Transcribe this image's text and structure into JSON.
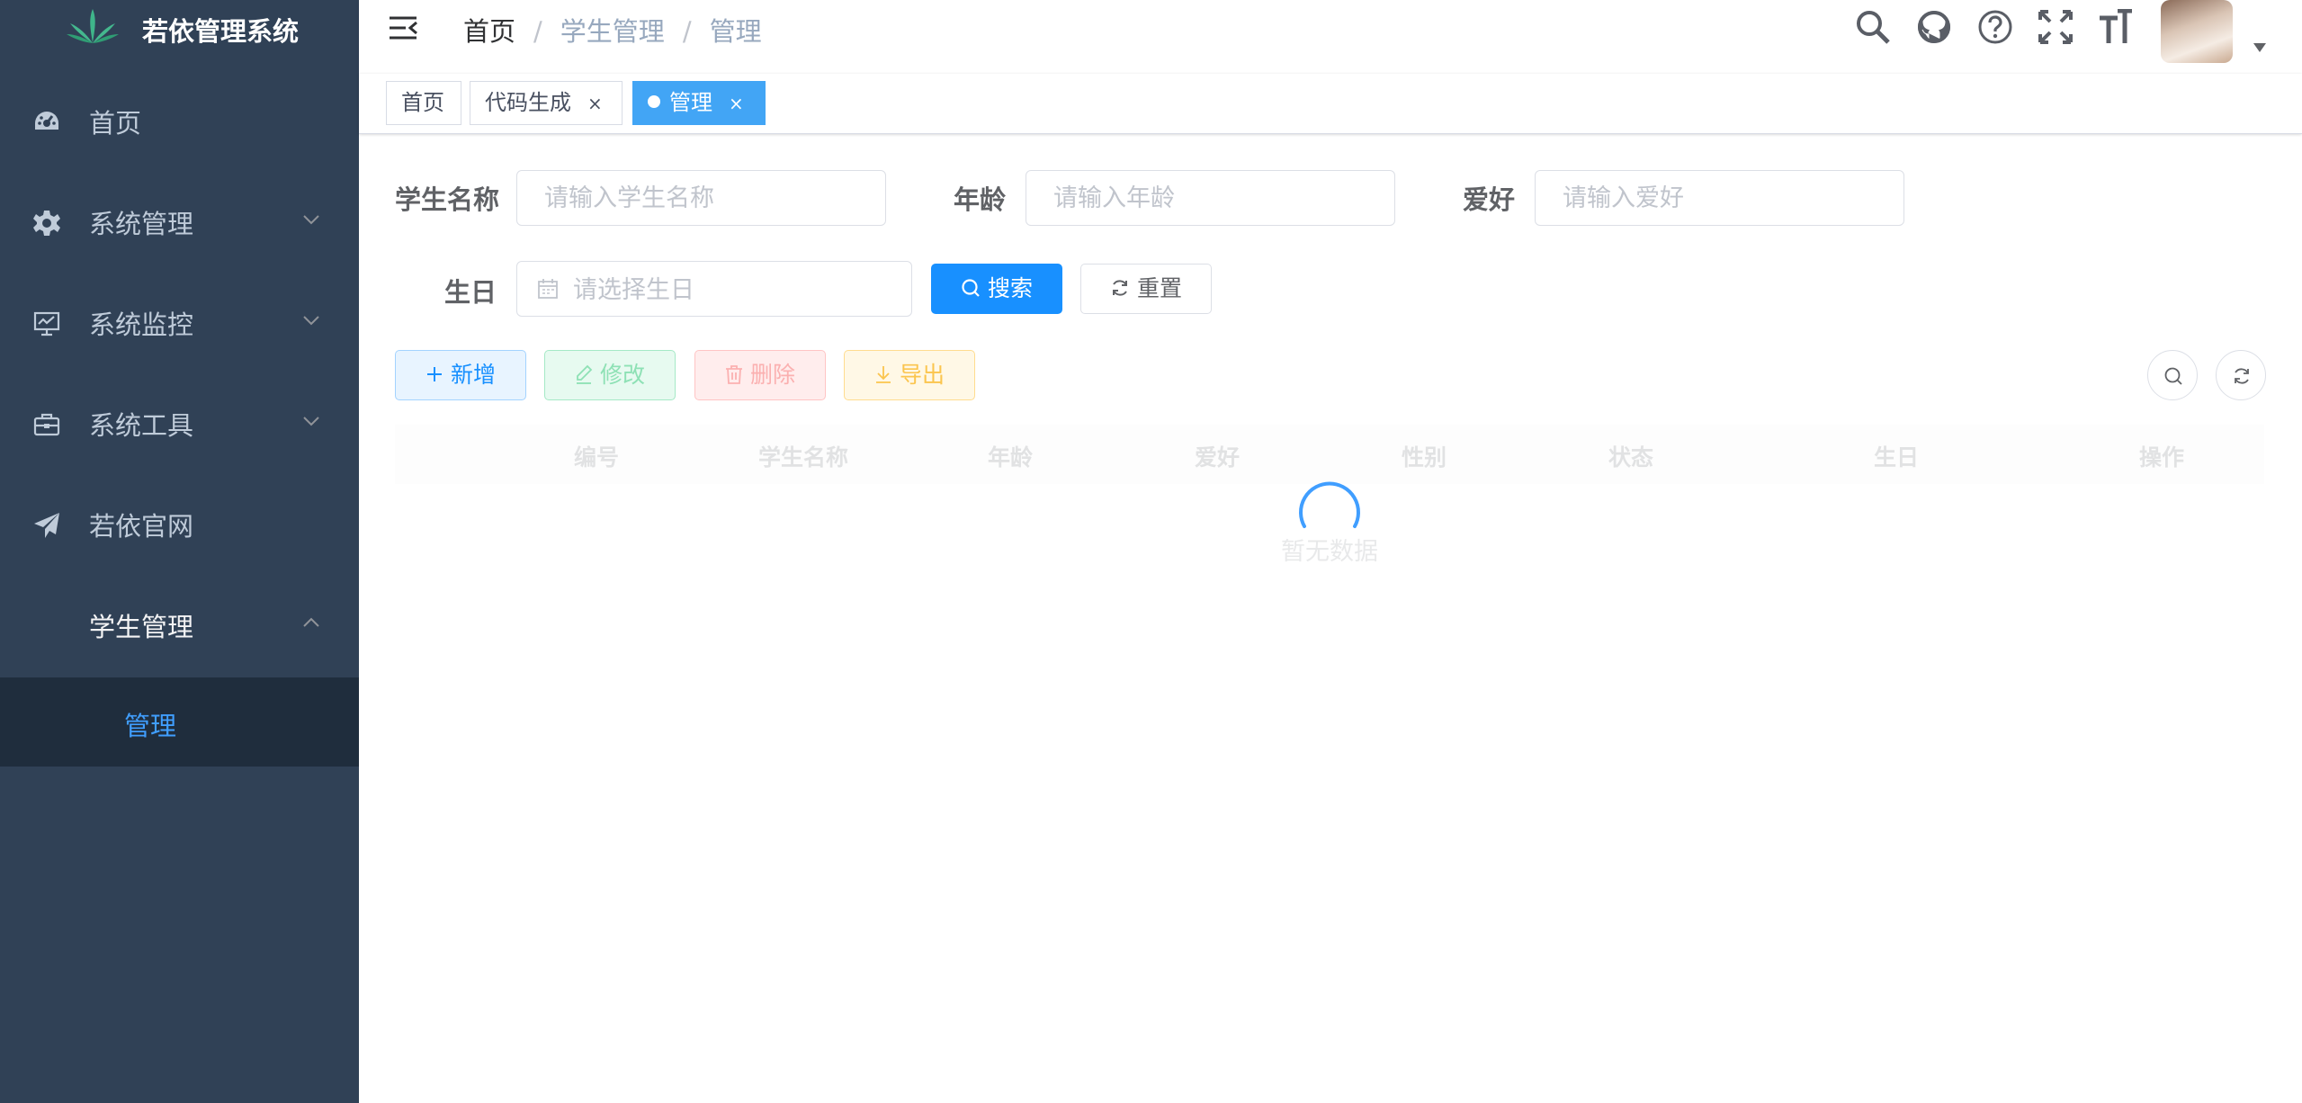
{
  "app": {
    "title": "若依管理系统"
  },
  "sidebar": {
    "items": [
      {
        "label": "首页",
        "icon": "dashboard-icon"
      },
      {
        "label": "系统管理",
        "icon": "gear-icon",
        "expandable": true
      },
      {
        "label": "系统监控",
        "icon": "monitor-icon",
        "expandable": true
      },
      {
        "label": "系统工具",
        "icon": "toolbox-icon",
        "expandable": true
      },
      {
        "label": "若依官网",
        "icon": "paper-plane-icon"
      },
      {
        "label": "学生管理",
        "expanded": true,
        "children": [
          {
            "label": "管理",
            "active": true
          }
        ]
      }
    ]
  },
  "breadcrumb": [
    "首页",
    "学生管理",
    "管理"
  ],
  "navbar_icons": [
    "search-icon",
    "github-icon",
    "help-icon",
    "fullscreen-icon",
    "font-size-icon"
  ],
  "tags": [
    {
      "label": "首页",
      "closable": false,
      "active": false
    },
    {
      "label": "代码生成",
      "closable": true,
      "active": false
    },
    {
      "label": "管理",
      "closable": true,
      "active": true
    }
  ],
  "form": {
    "name_label": "学生名称",
    "name_placeholder": "请输入学生名称",
    "age_label": "年龄",
    "age_placeholder": "请输入年龄",
    "hobby_label": "爱好",
    "hobby_placeholder": "请输入爱好",
    "birthday_label": "生日",
    "birthday_placeholder": "请选择生日",
    "search_label": "搜索",
    "reset_label": "重置"
  },
  "toolbar": {
    "add_label": "新增",
    "edit_label": "修改",
    "delete_label": "删除",
    "export_label": "导出"
  },
  "table": {
    "columns": [
      "编号",
      "学生名称",
      "年龄",
      "爱好",
      "性别",
      "状态",
      "生日",
      "操作"
    ],
    "empty_text": "暂无数据",
    "loading": true
  },
  "colors": {
    "sidebar_bg": "#304156",
    "submenu_bg": "#1f2d3d",
    "primary": "#1890ff",
    "active_tag": "#42a5f5",
    "active_text": "#409eff"
  }
}
